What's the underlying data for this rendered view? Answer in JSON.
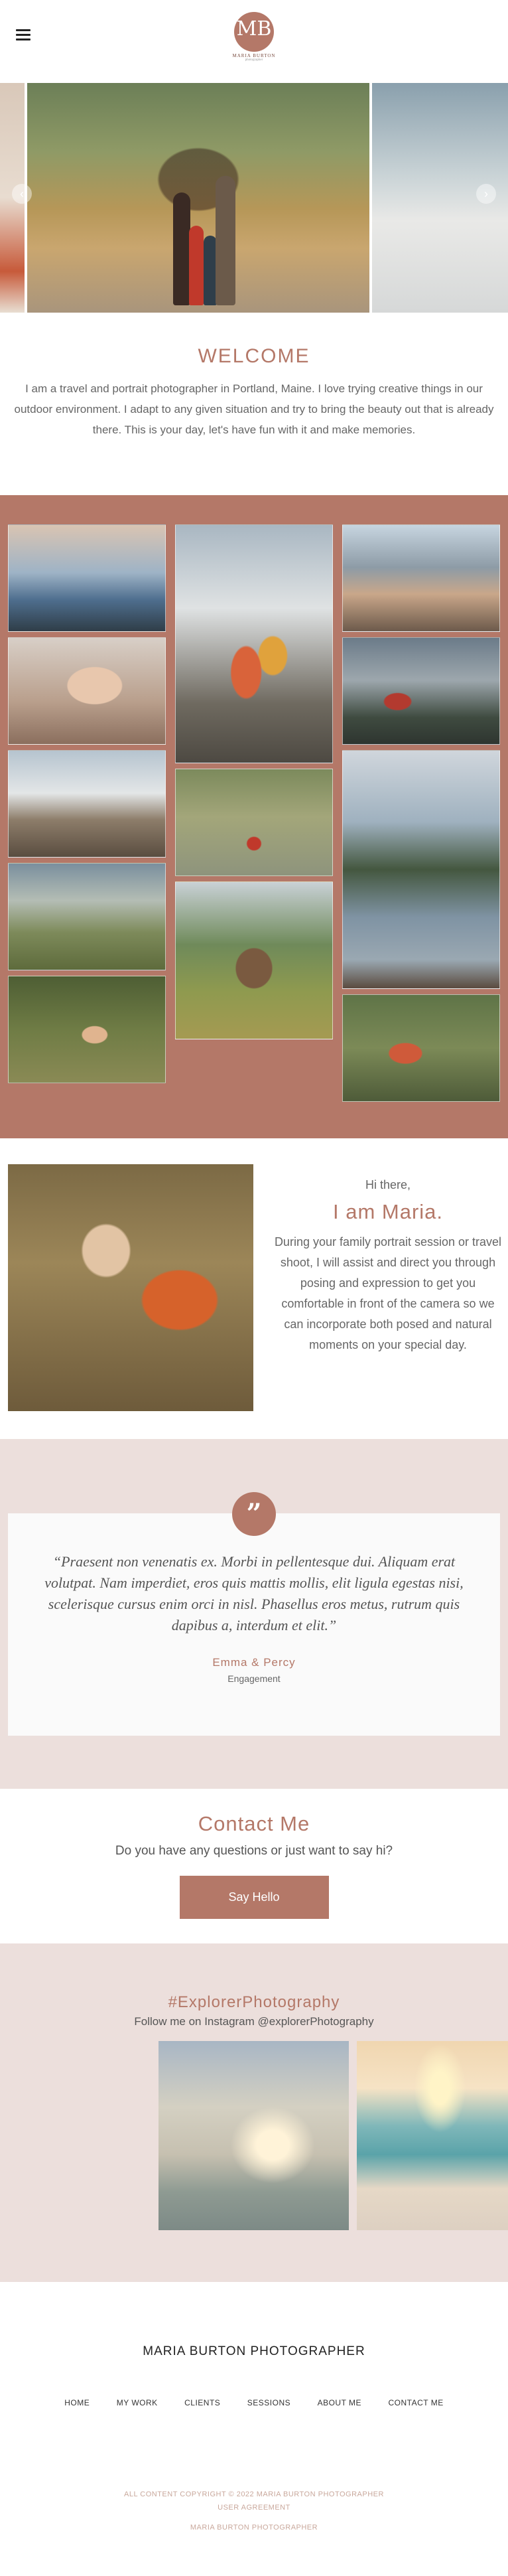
{
  "header": {
    "logo_monogram": "MB",
    "logo_name": "MARIA BURTON",
    "logo_sub": "photographer"
  },
  "slider": {
    "prev_icon": "chevron-left-icon",
    "next_icon": "chevron-right-icon",
    "prev_glyph": "‹",
    "next_glyph": "›"
  },
  "welcome": {
    "title": "WELCOME",
    "body": "I am a travel and portrait photographer in Portland, Maine. I love trying creative things in our outdoor environment. I adapt to any given situation and try to bring the beauty out that is already there. This is your day, let's have fun with it and make memories."
  },
  "about": {
    "greeting": "Hi there,",
    "name": "I am Maria.",
    "body": "During your family portrait session or travel shoot, I will assist and direct you through posing and expression to get you comfortable in front of the camera so we can incorporate both posed and natural moments on your special day."
  },
  "testimonial": {
    "quote_glyph": "”",
    "quote": "“Praesent non venenatis ex. Morbi in pellentesque dui. Aliquam erat volutpat. Nam imperdiet, eros quis mattis mollis, elit ligula egestas nisi, scelerisque cursus enim orci in nisl. Phasellus eros metus, rutrum quis dapibus a, interdum et elit.”",
    "author": "Emma & Percy",
    "session": "Engagement"
  },
  "contact": {
    "title": "Contact Me",
    "subtitle": "Do you have any questions or just want to say hi?",
    "button": "Say Hello"
  },
  "instagram": {
    "title": "#ExplorerPhotography",
    "subtitle": "Follow me on Instagram @explorerPhotography"
  },
  "footer": {
    "name": "MARIA BURTON PHOTOGRAPHER",
    "nav": [
      "HOME",
      "MY WORK",
      "CLIENTS",
      "SESSIONS",
      "ABOUT ME",
      "CONTACT ME"
    ],
    "copyright": "ALL CONTENT COPYRIGHT © 2022 MARIA BURTON PHOTOGRAPHER",
    "user_agreement": "USER AGREEMENT",
    "credit": "MARIA BURTON PHOTOGRAPHER"
  },
  "colors": {
    "accent": "#b47868",
    "blush": "#ecdfdc"
  }
}
